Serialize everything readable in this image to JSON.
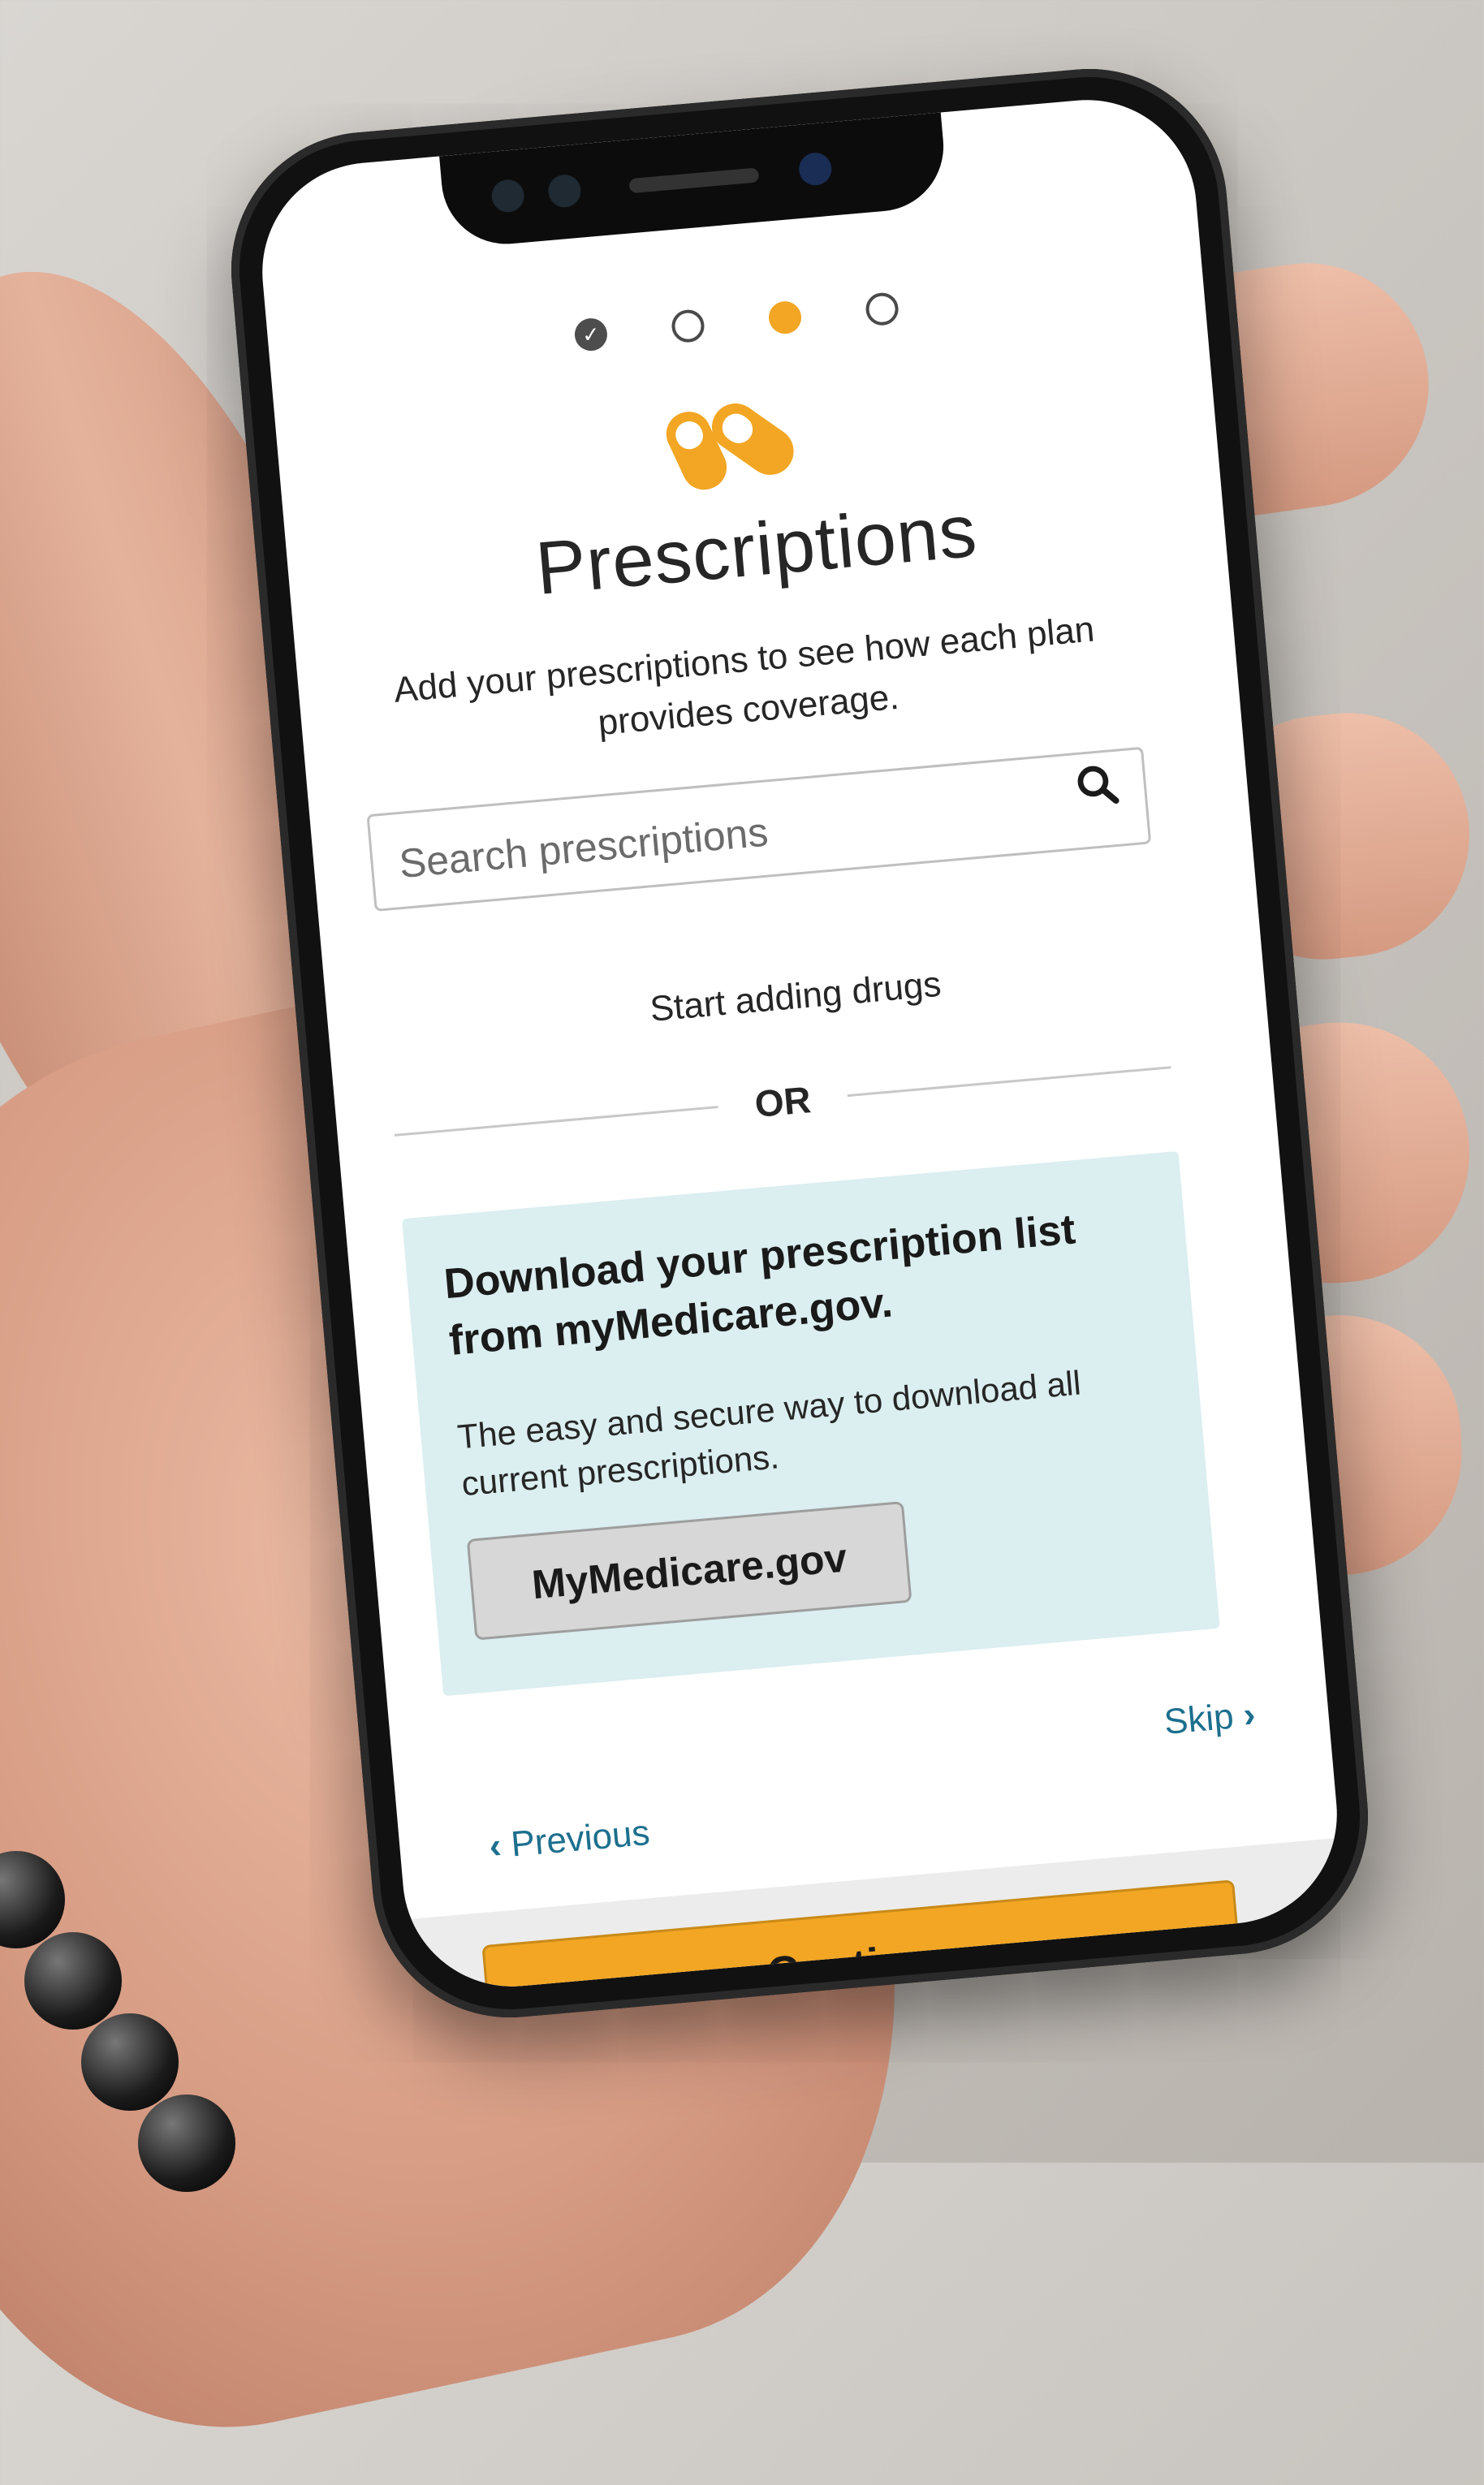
{
  "progress": {
    "steps": [
      {
        "state": "done",
        "icon": "checkmark-icon"
      },
      {
        "state": "open"
      },
      {
        "state": "active"
      },
      {
        "state": "open"
      }
    ]
  },
  "header": {
    "icon": "pills-icon",
    "title": "Prescriptions",
    "subtitle": "Add your prescriptions to see how each plan provides coverage."
  },
  "search": {
    "placeholder": "Search prescriptions",
    "icon": "search-icon"
  },
  "start_text": "Start adding drugs",
  "divider_text": "OR",
  "mymedicare": {
    "title": "Download your prescription list from myMedicare.gov.",
    "text": "The easy and secure way to download all current prescriptions.",
    "button_label": "MyMedicare.gov"
  },
  "nav": {
    "skip_label": "Skip",
    "previous_label": "Previous",
    "continue_label": "Continue"
  },
  "colors": {
    "accent": "#f2a623",
    "link": "#1d6f8e",
    "card_bg": "#dbeef0"
  }
}
